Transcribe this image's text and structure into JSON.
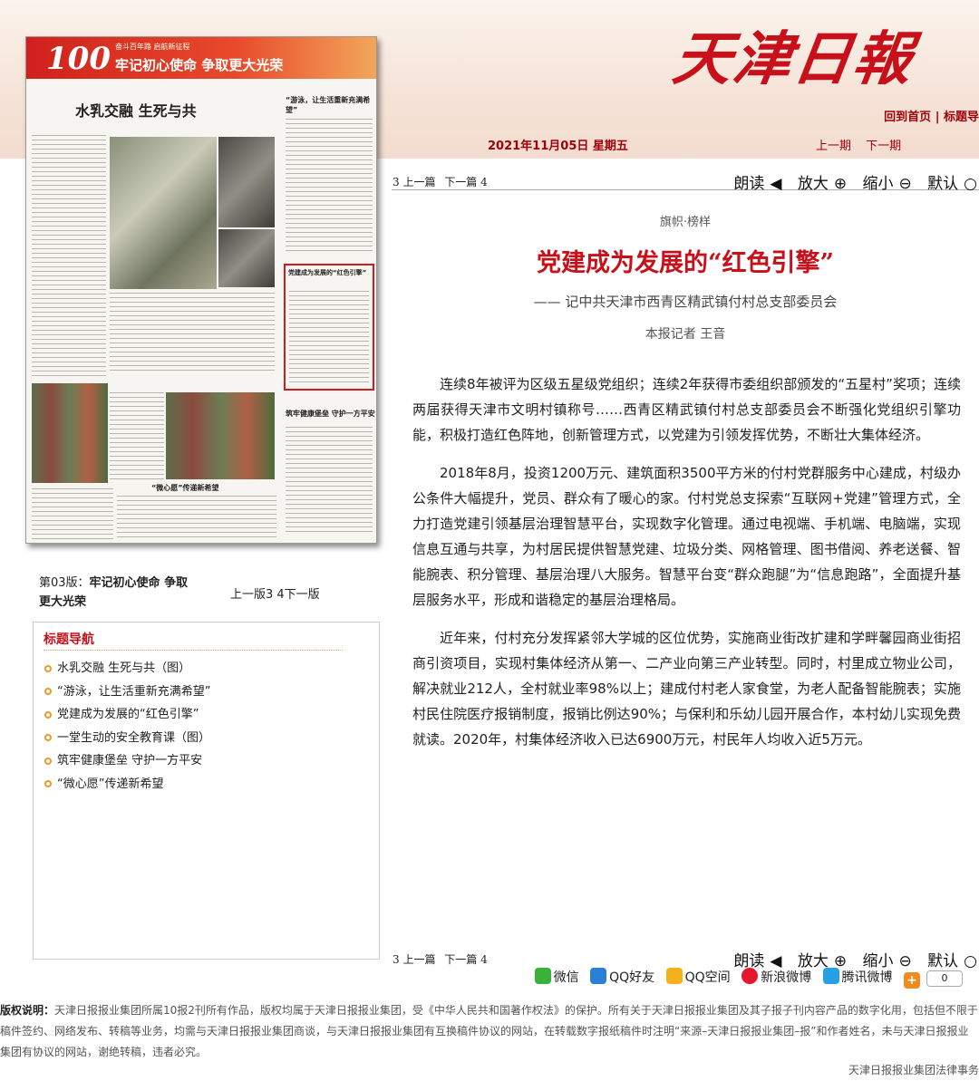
{
  "header": {
    "logo": "天津日報",
    "links": [
      "回到首页",
      "标题导"
    ],
    "date": "2021年11月05日 星期五",
    "edition_prev": "上一期",
    "edition_next": "下一期"
  },
  "paper_thumb": {
    "banner_number": "100",
    "banner_small": "奋斗百年路 启航新征程",
    "banner_slogan": "牢记初心使命 争取更大光荣",
    "headline": "水乳交融 生死与共",
    "box_title": "党建成为发展的“红色引擎”",
    "small_title_1": "“游泳，让生活重新充满希望”",
    "small_title_2": "筑牢健康堡垒 守护一方平安",
    "small_title_3": "“微心愿”传递新希望"
  },
  "page_info": {
    "label": "第03版：",
    "name": "牢记初心使命 争取更大光荣",
    "nav": "上一版3  4下一版"
  },
  "nav": {
    "title": "标题导航",
    "items": [
      "水乳交融 生死与共（图）",
      "“游泳，让生活重新充满希望”",
      "党建成为发展的“红色引擎”",
      "一堂生动的安全教育课（图）",
      "筑牢健康堡垒 守护一方平安",
      "“微心愿”传递新希望"
    ]
  },
  "article_bar": {
    "prev": "3 上一篇",
    "next": "下一篇 4",
    "read": "朗读",
    "zoom_in": "放大",
    "zoom_out": "缩小",
    "default": "默认"
  },
  "article": {
    "kicker": "旗帜·榜样",
    "title": "党建成为发展的“红色引擎”",
    "subtitle": "—— 记中共天津市西青区精武镇付村总支部委员会",
    "byline": "本报记者 王音",
    "paragraphs": [
      "连续8年被评为区级五星级党组织；连续2年获得市委组织部颁发的“五星村”奖项；连续两届获得天津市文明村镇称号……西青区精武镇付村总支部委员会不断强化党组织引擎功能，积极打造红色阵地，创新管理方式，以党建为引领发挥优势，不断壮大集体经济。",
      "2018年8月，投资1200万元、建筑面积3500平方米的付村党群服务中心建成，村级办公条件大幅提升，党员、群众有了暖心的家。付村党总支探索“互联网+党建”管理方式，全力打造党建引领基层治理智慧平台，实现数字化管理。通过电视端、手机端、电脑端，实现信息互通与共享，为村居民提供智慧党建、垃圾分类、网格管理、图书借阅、养老送餐、智能腕表、积分管理、基层治理八大服务。智慧平台变“群众跑腿”为“信息跑路”，全面提升基层服务水平，形成和谐稳定的基层治理格局。",
      "近年来，付村充分发挥紧邻大学城的区位优势，实施商业街改扩建和学畔馨园商业街招商引资项目，实现村集体经济从第一、二产业向第三产业转型。同时，村里成立物业公司，解决就业212人，全村就业率98%以上；建成付村老人家食堂，为老人配备智能腕表；实施村民住院医疗报销制度，报销比例达90%；与保利和乐幼儿园开展合作，本村幼儿实现免费就读。2020年，村集体经济收入已达6900万元，村民年人均收入近5万元。"
    ]
  },
  "share": {
    "wechat": "微信",
    "qq_friend": "QQ好友",
    "qzone": "QQ空间",
    "sina": "新浪微博",
    "tencent": "腾讯微博",
    "count": "0"
  },
  "colors": {
    "accent_red": "#c8101a",
    "header_bg": "#f6e4d9",
    "bullet_orange": "#e89a2a"
  },
  "footer": {
    "label": "版权说明：",
    "text": "天津日报报业集团所属10报2刊所有作品，版权均属于天津日报报业集团，受《中华人民共和国著作权法》的保护。所有关于天津日报报业集团及其子报子刊内容产品的数字化用，包括但不限于稿件签约、网络发布、转稿等业务，均需与天津日报报业集团商谈，与天津日报报业集团有互换稿件协议的网站，在转载数字报纸稿件时注明“来源–天津日报报业集团–报”和作者姓名，未与天津日报报业集团有协议的网站，谢绝转稿，违者必究。",
    "right": "天津日报报业集团法律事务"
  }
}
